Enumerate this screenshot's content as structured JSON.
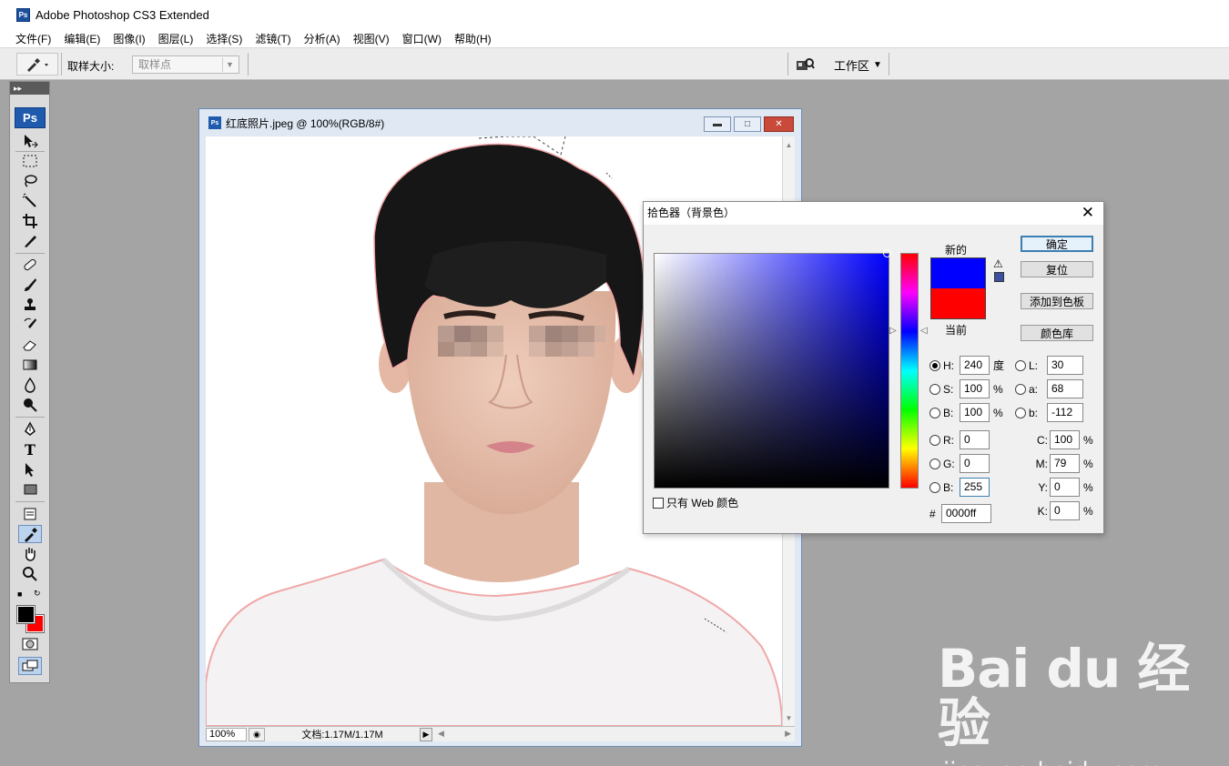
{
  "app": {
    "title": "Adobe Photoshop CS3 Extended",
    "logo": "Ps"
  },
  "menu": [
    "文件(F)",
    "编辑(E)",
    "图像(I)",
    "图层(L)",
    "选择(S)",
    "滤镜(T)",
    "分析(A)",
    "视图(V)",
    "窗口(W)",
    "帮助(H)"
  ],
  "options": {
    "sample_size_label": "取样大小:",
    "sample_size_value": "取样点",
    "workspace_label": "工作区"
  },
  "toolbox": {
    "badge": "Ps",
    "active_tool": "eyedropper-tool"
  },
  "document": {
    "title": "红底照片.jpeg @ 100%(RGB/8#)",
    "zoom": "100%",
    "doc_info": "文档:1.17M/1.17M"
  },
  "color_picker": {
    "title": "拾色器（背景色）",
    "new_label": "新的",
    "current_label": "当前",
    "new_color": "#0000ff",
    "current_color": "#ff0000",
    "buttons": {
      "ok": "确定",
      "reset": "复位",
      "add_swatch": "添加到色板",
      "libraries": "颜色库"
    },
    "web_only": "只有 Web 颜色",
    "hsb": {
      "H_label": "H:",
      "H": "240",
      "H_unit": "度",
      "S_label": "S:",
      "S": "100",
      "S_unit": "%",
      "B_label": "B:",
      "B": "100",
      "B_unit": "%"
    },
    "rgb": {
      "R_label": "R:",
      "R": "0",
      "G_label": "G:",
      "G": "0",
      "B_label": "B:",
      "B": "255"
    },
    "lab": {
      "L_label": "L:",
      "L": "30",
      "a_label": "a:",
      "a": "68",
      "b_label": "b:",
      "b": "-112"
    },
    "cmyk": {
      "C_label": "C:",
      "C": "100",
      "M_label": "M:",
      "M": "79",
      "Y_label": "Y:",
      "Y": "0",
      "K_label": "K:",
      "K": "0",
      "unit": "%"
    },
    "hex_label": "#",
    "hex": "0000ff"
  },
  "watermark": {
    "logo": "Bai du 经验",
    "url": "jingyan.baidu.com"
  }
}
